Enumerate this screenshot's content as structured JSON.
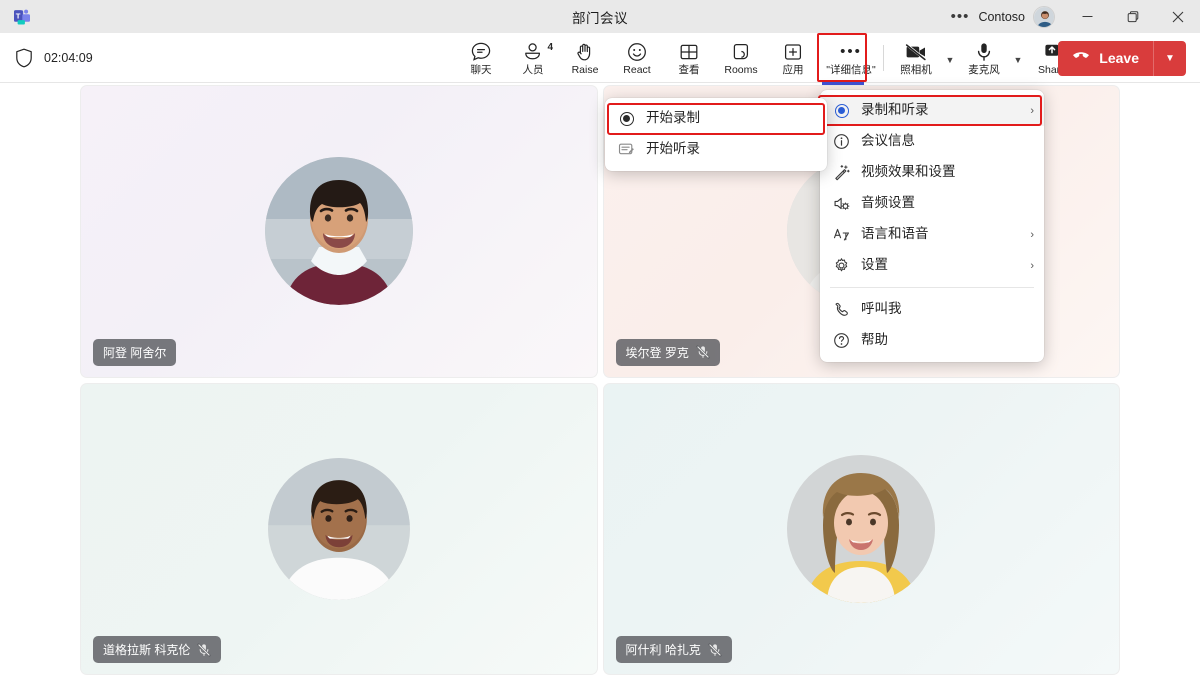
{
  "titlebar": {
    "title": "部门会议",
    "more_icon": "ellipsis-icon",
    "org": "Contoso",
    "avatar_icon": "user-avatar",
    "minimize": "minimize-icon",
    "maximize": "maximize-icon",
    "close": "close-icon"
  },
  "toolbar": {
    "shield_icon": "shield-icon",
    "timer": "02:04:09",
    "buttons": [
      {
        "label": "聊天",
        "icon": "chat-icon",
        "badge": ""
      },
      {
        "label": "人员",
        "icon": "people-icon",
        "badge": "4"
      },
      {
        "label": "Raise",
        "icon": "raise-hand-icon",
        "badge": ""
      },
      {
        "label": "React",
        "icon": "react-emoji-icon",
        "badge": ""
      },
      {
        "label": "查看",
        "icon": "view-grid-icon",
        "badge": ""
      },
      {
        "label": "Rooms",
        "icon": "breakout-rooms-icon",
        "badge": ""
      },
      {
        "label": "应用",
        "icon": "apps-plus-icon",
        "badge": ""
      }
    ],
    "more": {
      "label": "\"详细信息\"",
      "icon": "ellipsis-icon"
    },
    "camera": {
      "label": "照相机",
      "icon": "camera-off-icon",
      "chevron": "chevron-down-icon"
    },
    "mic": {
      "label": "麦克风",
      "icon": "microphone-icon",
      "chevron": "chevron-down-icon"
    },
    "share": {
      "label": "Share",
      "icon": "share-screen-icon"
    },
    "leave": {
      "label": "Leave",
      "icon": "hangup-icon",
      "chevron": "chevron-down-icon",
      "color": "#d93c3c"
    }
  },
  "annotation": {
    "color": "#e21b1b"
  },
  "participants": [
    {
      "name": "阿登 阿舍尔",
      "muted": false,
      "tile": "t1"
    },
    {
      "name": "埃尔登 罗克",
      "muted": true,
      "tile": "t2"
    },
    {
      "name": "道格拉斯 科克伦",
      "muted": true,
      "tile": "t3"
    },
    {
      "name": "阿什利 哈扎克",
      "muted": true,
      "tile": "t4"
    }
  ],
  "menu": {
    "items": [
      {
        "label": "录制和听录",
        "icon": "record-circle-icon",
        "arrow": "›",
        "highlighted": true
      },
      {
        "label": "会议信息",
        "icon": "info-circle-icon",
        "arrow": ""
      },
      {
        "label": "视频效果和设置",
        "icon": "magic-wand-icon",
        "arrow": ""
      },
      {
        "label": "音频设置",
        "icon": "speaker-settings-icon",
        "arrow": ""
      },
      {
        "label": "语言和语音",
        "icon": "translate-icon",
        "arrow": "›"
      },
      {
        "label": "设置",
        "icon": "gear-icon",
        "arrow": "›"
      }
    ],
    "footer_items": [
      {
        "label": "呼叫我",
        "icon": "phone-icon"
      },
      {
        "label": "帮助",
        "icon": "help-circle-icon"
      }
    ]
  },
  "submenu": {
    "items": [
      {
        "label": "开始录制",
        "icon": "record-circle-icon",
        "highlighted": true
      },
      {
        "label": "开始听录",
        "icon": "transcript-icon",
        "highlighted": false
      }
    ]
  }
}
